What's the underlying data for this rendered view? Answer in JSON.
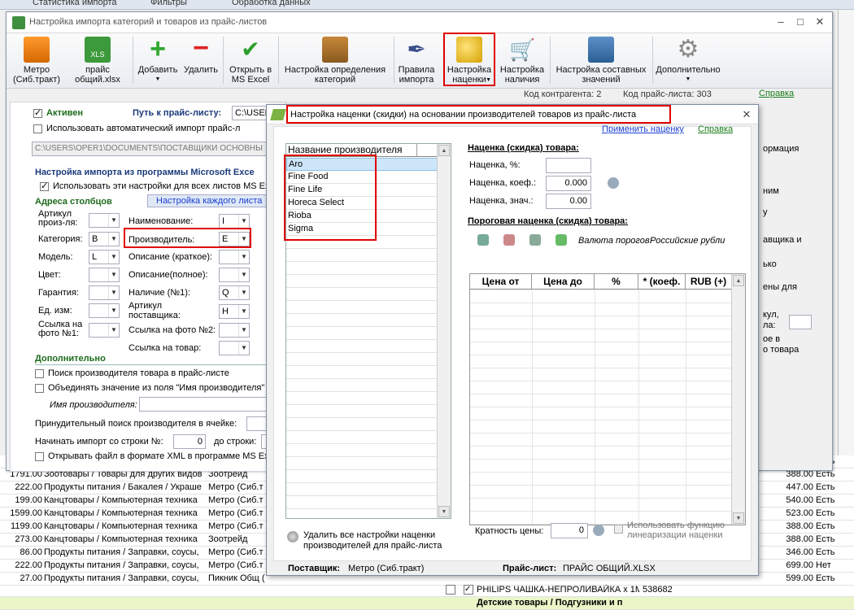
{
  "bg": {
    "top_tabs": [
      "Статистика импорта",
      "Фильтры",
      "Обработка данных"
    ],
    "rows": [
      {
        "n": "1338.00",
        "cat": "Зоотовары / Товары для других видов",
        "sup": "Зоотрейд",
        "price": "388.00",
        "st": "Есть"
      },
      {
        "n": "1791.00",
        "cat": "Зоотовары / Товары для других видов",
        "sup": "Зоотрейд",
        "price": "388.00",
        "st": "Есть"
      },
      {
        "n": "222.00",
        "cat": "Продукты питания / Бакалея / Украше",
        "sup": "Метро (Сиб.т",
        "price": "447.00",
        "st": "Есть"
      },
      {
        "n": "199.00",
        "cat": "Канцтовары / Компьютерная техника",
        "sup": "Метро (Сиб.т",
        "price": "540.00",
        "st": "Есть"
      },
      {
        "n": "1599.00",
        "cat": "Канцтовары / Компьютерная техника",
        "sup": "Метро (Сиб.т",
        "price": "523.00",
        "st": "Есть"
      },
      {
        "n": "1199.00",
        "cat": "Канцтовары / Компьютерная техника",
        "sup": "Метро (Сиб.т",
        "price": "388.00",
        "st": "Есть"
      },
      {
        "n": "273.00",
        "cat": "Канцтовары / Компьютерная техника",
        "sup": "Зоотрейд",
        "price": "388.00",
        "st": "Есть"
      },
      {
        "n": "86.00",
        "cat": "Продукты питания / Заправки, соусы,",
        "sup": "Метро (Сиб.т",
        "price": "346.00",
        "st": "Есть"
      },
      {
        "n": "222.00",
        "cat": "Продукты питания / Заправки, соусы,",
        "sup": "Метро (Сиб.т",
        "price": "699.00",
        "st": "Нет"
      },
      {
        "n": "27.00",
        "cat": "Продукты питания / Заправки, соусы,",
        "sup": "Пикник Общ (Нет",
        "price": "599.00",
        "st": "Есть"
      }
    ],
    "bottom_item": "PHILIPS ЧАШКА-НЕПРОЛИВАЙКА х 1МЕ",
    "bottom_code": "538682",
    "bottom_cat": "Детские товары / Подгузники и п"
  },
  "main": {
    "title": "Настройка импорта категорий и товаров из прайс-листов",
    "toolbar": [
      {
        "label": "Метро\n(Сиб.тракт)",
        "icon": "truck-icon"
      },
      {
        "label": "прайс\nобщий.xlsx",
        "icon": "excel-file-icon"
      },
      {
        "label": "Добавить",
        "icon": "plus-icon"
      },
      {
        "label": "Удалить",
        "icon": "minus-icon"
      },
      {
        "label": "Открыть в\nMS Excel",
        "icon": "checkmark-icon"
      },
      {
        "label": "Настройка определения\nкатегорий",
        "icon": "category-icon"
      },
      {
        "label": "Правила\nимпорта",
        "icon": "feather-icon"
      },
      {
        "label": "Настройка\nнаценки",
        "icon": "coins-icon"
      },
      {
        "label": "Настройка\nналичия",
        "icon": "cart-icon"
      },
      {
        "label": "Настройка составных\nзначений",
        "icon": "tools-icon"
      },
      {
        "label": "Дополнительно",
        "icon": "gear-icon"
      }
    ],
    "status": {
      "counterparty": "Код контрагента: 2",
      "pricelist": "Код прайс-листа: 303",
      "help": "Справка"
    },
    "form": {
      "active": "Активен",
      "auto_import": "Использовать автоматический импорт прайс-л",
      "path_label": "Путь к прайс-листу:",
      "path_value": "C:\\USER",
      "path_full": "C:\\USERS\\OPER1\\DOCUMENTS\\ПОСТАВЩИКИ ОСНОВНЫ",
      "excel_section": "Настройка импорта из программы Microsoft Exce",
      "all_sheets": "Использовать эти настройки для всех листов MS Exc",
      "each_sheet": "Настройка каждого листа",
      "columns_section": "Адреса столбцов",
      "article": "Артикул\nпроиз-ля:",
      "category": "Категория:",
      "category_val": "B",
      "model": "Модель:",
      "model_val": "L",
      "color": "Цвет:",
      "warranty": "Гарантия:",
      "unit": "Ед. изм:",
      "photo1": "Ссылка на\nфото №1:",
      "name": "Наименование:",
      "name_val": "I",
      "manufacturer": "Производитель:",
      "manufacturer_val": "E",
      "desc_short": "Описание (краткое):",
      "desc_full": "Описание(полное):",
      "availability": "Наличие (№1):",
      "availability_val": "Q",
      "sup_article": "Артикул\nпоставщика:",
      "sup_article_val": "H",
      "photo2": "Ссылка на фото №2:",
      "product_link": "Ссылка на товар:",
      "extra_section": "Дополнительно",
      "search_manuf": "Поиск производителя товара в прайс-листе",
      "merge_field": "Объединять значение из поля \"Имя производителя\"",
      "manuf_name": "Имя производителя:",
      "forced_search": "Принудительный поиск производителя в ячейке:",
      "start_row": "Начинать импорт со строки №:",
      "start_row_val": "0",
      "to_row": "до строки:",
      "open_xml": "Открывать файл в формате XML в программе MS Exce"
    },
    "rform": [
      "ормация",
      "ним",
      "у",
      "авщика и",
      "ько",
      "ены для",
      "кул,",
      "ла:",
      "ое в",
      "о товара"
    ]
  },
  "dialog": {
    "title": "Настройка наценки (скидки) на основании производителей товаров из прайс-листа",
    "apply_link": "Применить наценку",
    "help_link": "Справка",
    "list_header": "Название производителя",
    "manufacturers": [
      "Aro",
      "Fine Food",
      "Fine Life",
      "Horeca Select",
      "Rioba",
      "Sigma"
    ],
    "markup_title": "Наценка (скидка) товара:",
    "markup_pct_label": "Наценка, %:",
    "markup_pct": "",
    "markup_coef_label": "Наценка, коеф.:",
    "markup_coef": "0.000",
    "markup_val_label": "Наценка, знач.:",
    "markup_val": "0.00",
    "threshold_title": "Пороговая наценка (скидка) товара:",
    "currency_label": "Валюта порогов:",
    "currency_value": "Российские рубли",
    "table_headers": [
      "Цена от",
      "Цена до",
      "%",
      "* (коеф.",
      "RUB (+)"
    ],
    "delete_all": "Удалить все настройки наценки\nпроизводителей для прайс-листа",
    "multiplicity_label": "Кратность цены:",
    "multiplicity": "0",
    "linearize": "Использовать функцию\nлинеаризации наценки",
    "supplier_label": "Поставщик:",
    "supplier": "Метро (Сиб.тракт)",
    "pricelist_label": "Прайс-лист:",
    "pricelist": "ПРАЙС ОБЩИЙ.XLSX"
  }
}
